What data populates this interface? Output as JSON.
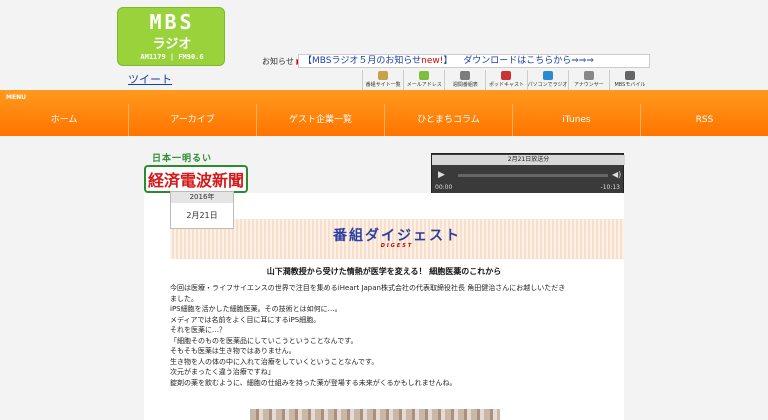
{
  "header": {
    "logo": {
      "line1": "MBS",
      "line2": "ラジオ",
      "line3": "AM1179 | FM90.6"
    },
    "tweet": "ツイート",
    "notice_label": "お知らせ",
    "notice_arrow": "▶",
    "notice_text": "【MBSラジオ５月のお知らせ",
    "notice_new": "new!",
    "notice_close": "】",
    "download_text": "ダウンロードはこちらから⇒⇒⇒",
    "icons": [
      {
        "label": "番組サイト一覧",
        "icon": "list-icon",
        "color": "#c8a24a"
      },
      {
        "label": "メールアドレス",
        "icon": "mail-icon",
        "color": "#7cbf3c"
      },
      {
        "label": "週間番組表",
        "icon": "calendar-icon",
        "color": "#7c7c7c"
      },
      {
        "label": "ポッドキャスト",
        "icon": "podcast-icon",
        "color": "#c33"
      },
      {
        "label": "パソコンでラジオを聴こう",
        "icon": "radio-icon",
        "color": "#2a8ad4"
      },
      {
        "label": "アナウンサー",
        "icon": "microphone-icon",
        "color": "#888"
      },
      {
        "label": "MBSモバイル",
        "icon": "mobile-icon",
        "color": "#666"
      }
    ]
  },
  "menu": {
    "label": "MENU",
    "items": [
      "ホーム",
      "アーカイブ",
      "ゲスト企業一覧",
      "ひとまちコラム",
      "iTunes",
      "RSS"
    ]
  },
  "program": {
    "logo_top": "日本一明るい",
    "logo_main": "経済電波新聞"
  },
  "player": {
    "title": "2月21日放送分",
    "time_start": "00:00",
    "time_end": "-10:13"
  },
  "date": {
    "year": "2016年",
    "day": "2月21日"
  },
  "digest": {
    "title": "番組ダイジェスト",
    "subtitle": "DIGEST"
  },
  "article": {
    "headline": "山下潤教授から受けた情熱が医学を変える！ 細胞医薬のこれから",
    "lines": [
      "今回は医療・ライフサイエンスの世界で注目を集めるiHeart Japan株式会社の代表取締役社長 角田健治さんにお越しいただき",
      "ました。",
      "iPS細胞を活かした細胞医薬。その技術とは如何に…。",
      "メディアでは名前をよく目に耳にするiPS細胞。",
      "それを医薬に…？",
      "「細胞そのものを医薬品にしていこうということなんです。",
      "そもそも医薬は生き物ではありません。",
      "生き物を人の体の中に入れて治療をしていくということなんです。",
      "次元がまったく違う治療ですね」",
      "錠剤の薬を飲むように、細胞の仕組みを持った薬が登場する未来がくるかもしれませんね。"
    ]
  }
}
